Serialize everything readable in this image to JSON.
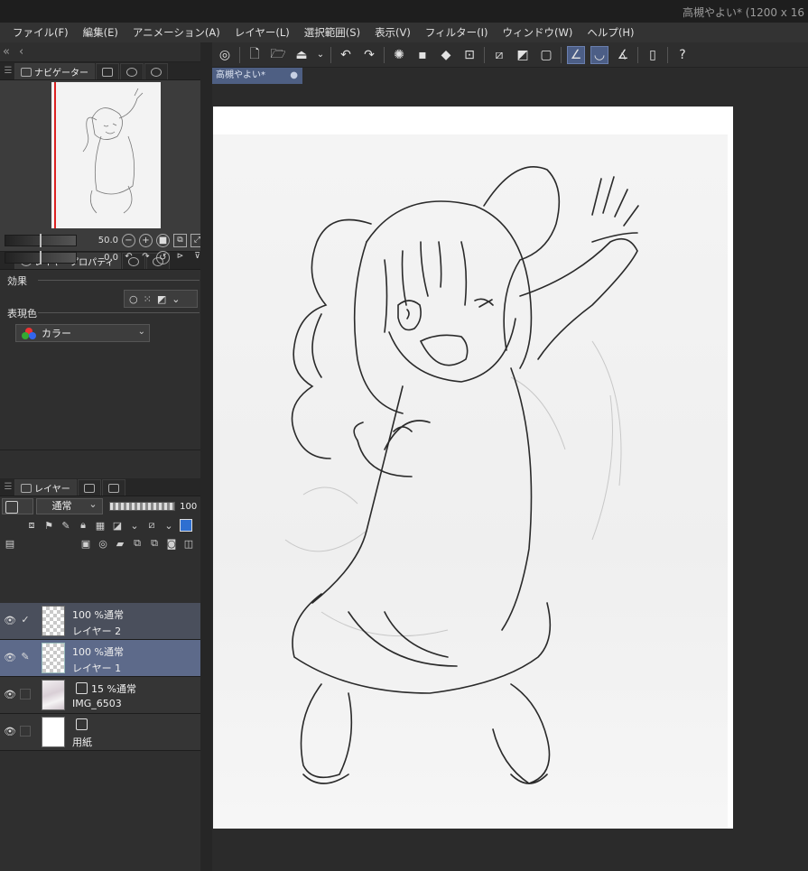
{
  "window": {
    "title": "高槻やよい* (1200 x 16"
  },
  "menu": [
    "ファイル(F)",
    "編集(E)",
    "アニメーション(A)",
    "レイヤー(L)",
    "選択範囲(S)",
    "表示(V)",
    "フィルター(I)",
    "ウィンドウ(W)",
    "ヘルプ(H)"
  ],
  "navigator": {
    "tab_label": "ナビゲーター",
    "zoom_value": "50.0",
    "rotate_value": "0.0"
  },
  "layer_property": {
    "tab_label": "レイヤープロパティ",
    "effect_label": "効果",
    "expression_color_label": "表現色",
    "expression_color_value": "カラー"
  },
  "layers_panel": {
    "tab_label": "レイヤー",
    "blend_mode": "通常",
    "opacity": "100",
    "layers": [
      {
        "name": "レイヤー 2",
        "mode": "100 %通常",
        "state": "check"
      },
      {
        "name": "レイヤー 1",
        "mode": "100 %通常",
        "state": "pen"
      },
      {
        "name": "IMG_6503",
        "mode": "15 %通常",
        "state": "none"
      },
      {
        "name": "用紙",
        "mode": "",
        "state": "none"
      }
    ]
  },
  "document": {
    "tab_label": "高槻やよい*"
  },
  "colors": {
    "selected_layer": "#5d6a8a",
    "doc_tab": "#4e5f83",
    "active_tool": "#4c5e86"
  }
}
